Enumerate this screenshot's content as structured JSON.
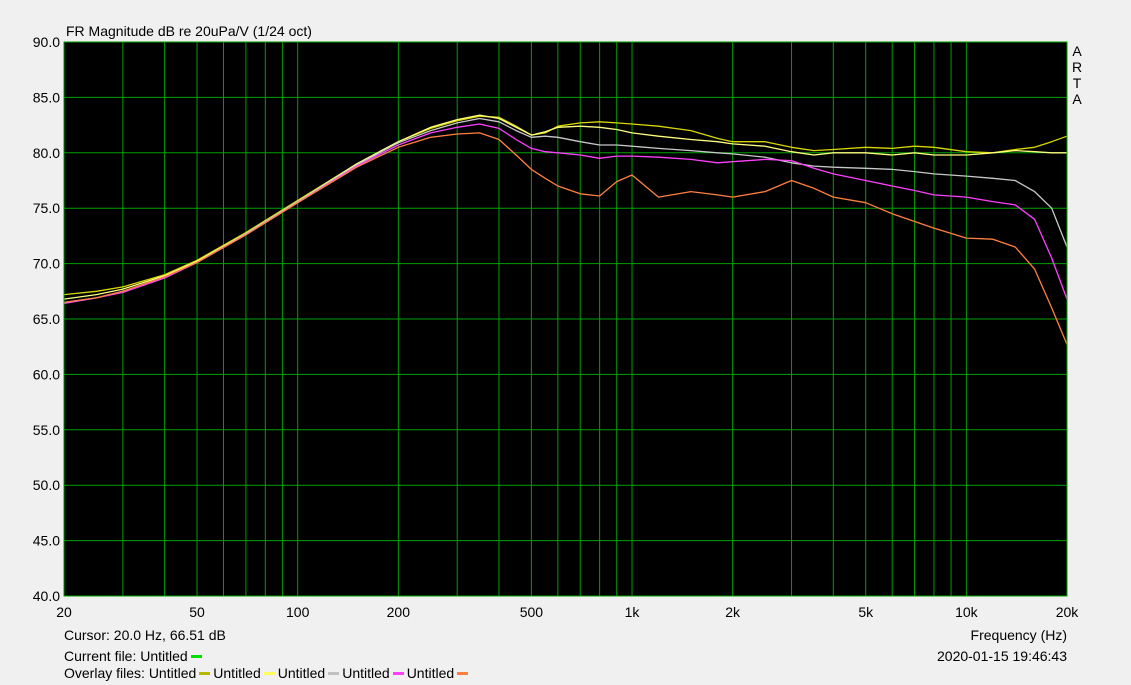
{
  "chart_data": {
    "type": "line",
    "title": "FR Magnitude dB re 20uPa/V (1/24 oct)",
    "xlabel": "Frequency (Hz)",
    "ylabel": "",
    "x_scale": "log",
    "xlim": [
      20,
      20000
    ],
    "ylim": [
      40,
      90
    ],
    "grid": true,
    "background": "#000000",
    "grid_color": "#00a000",
    "y_ticks": [
      "40.0",
      "45.0",
      "50.0",
      "55.0",
      "60.0",
      "65.0",
      "70.0",
      "75.0",
      "80.0",
      "85.0",
      "90.0"
    ],
    "y_tick_values": [
      40,
      45,
      50,
      55,
      60,
      65,
      70,
      75,
      80,
      85,
      90
    ],
    "x_ticks": [
      "20",
      "50",
      "100",
      "200",
      "500",
      "1k",
      "2k",
      "5k",
      "10k",
      "20k"
    ],
    "x_tick_values": [
      20,
      50,
      100,
      200,
      500,
      1000,
      2000,
      5000,
      10000,
      20000
    ],
    "x": [
      20,
      25,
      30,
      40,
      50,
      70,
      100,
      150,
      200,
      250,
      300,
      350,
      400,
      450,
      500,
      550,
      600,
      700,
      800,
      900,
      1000,
      1200,
      1500,
      1800,
      2000,
      2500,
      3000,
      3500,
      4000,
      5000,
      6000,
      7000,
      8000,
      10000,
      12000,
      14000,
      16000,
      18000,
      20000
    ],
    "series": [
      {
        "color": "#d8d800",
        "values": [
          67.2,
          67.5,
          67.9,
          69.0,
          70.3,
          72.8,
          75.7,
          79.0,
          81.0,
          82.2,
          82.9,
          83.3,
          83.2,
          82.4,
          81.6,
          81.8,
          82.4,
          82.7,
          82.8,
          82.7,
          82.6,
          82.4,
          82.0,
          81.3,
          81.0,
          81.0,
          80.5,
          80.2,
          80.3,
          80.5,
          80.4,
          80.6,
          80.5,
          80.1,
          80.0,
          80.3,
          80.5,
          81.0,
          81.5
        ]
      },
      {
        "color": "#ffff80",
        "values": [
          66.8,
          67.2,
          67.7,
          68.9,
          70.2,
          72.7,
          75.6,
          79.0,
          81.0,
          82.3,
          83.0,
          83.4,
          83.1,
          82.3,
          81.6,
          81.9,
          82.3,
          82.4,
          82.3,
          82.1,
          81.8,
          81.5,
          81.2,
          81.0,
          80.8,
          80.6,
          80.1,
          79.8,
          80.0,
          80.0,
          79.8,
          80.0,
          79.8,
          79.8,
          80.0,
          80.2,
          80.1,
          80.0,
          80.0
        ]
      },
      {
        "color": "#c8c8c8",
        "values": [
          66.5,
          66.9,
          67.5,
          68.8,
          70.1,
          72.7,
          75.6,
          78.9,
          80.9,
          82.0,
          82.7,
          83.1,
          82.8,
          82.0,
          81.4,
          81.5,
          81.4,
          81.0,
          80.7,
          80.7,
          80.6,
          80.4,
          80.2,
          80.0,
          79.9,
          79.6,
          79.1,
          78.8,
          78.7,
          78.6,
          78.5,
          78.3,
          78.1,
          77.9,
          77.7,
          77.5,
          76.5,
          75.0,
          71.5
        ]
      },
      {
        "color": "#ff40ff",
        "values": [
          66.4,
          66.9,
          67.4,
          68.7,
          70.1,
          72.6,
          75.5,
          78.8,
          80.7,
          81.8,
          82.3,
          82.6,
          82.2,
          81.2,
          80.4,
          80.1,
          80.0,
          79.8,
          79.5,
          79.7,
          79.7,
          79.6,
          79.4,
          79.1,
          79.2,
          79.4,
          79.3,
          78.6,
          78.1,
          77.5,
          77.0,
          76.6,
          76.2,
          76.0,
          75.6,
          75.3,
          74.0,
          70.5,
          66.8
        ]
      },
      {
        "color": "#ff8040",
        "values": [
          66.5,
          66.9,
          67.5,
          68.8,
          70.1,
          72.6,
          75.5,
          78.7,
          80.5,
          81.4,
          81.7,
          81.8,
          81.2,
          79.8,
          78.5,
          77.7,
          77.0,
          76.3,
          76.1,
          77.4,
          78.0,
          76.0,
          76.5,
          76.2,
          76.0,
          76.5,
          77.5,
          76.8,
          76.0,
          75.5,
          74.5,
          73.8,
          73.2,
          72.3,
          72.2,
          71.5,
          69.5,
          66.0,
          62.7
        ]
      }
    ]
  },
  "corner_label": [
    "A",
    "R",
    "T",
    "A"
  ],
  "footer": {
    "cursor": "Cursor: 20.0 Hz, 66.51 dB",
    "current_file_label": "Current file:",
    "current_file_name": "Untitled",
    "current_file_color": "#00e000",
    "overlay_label": "Overlay files:",
    "overlays": [
      {
        "name": "Untitled",
        "color": "#b8b800"
      },
      {
        "name": "Untitled",
        "color": "#ffff60"
      },
      {
        "name": "Untitled",
        "color": "#c0c0c0"
      },
      {
        "name": "Untitled",
        "color": "#ff40ff"
      },
      {
        "name": "Untitled",
        "color": "#ff8040"
      }
    ],
    "timestamp": "2020-01-15  19:46:43"
  }
}
